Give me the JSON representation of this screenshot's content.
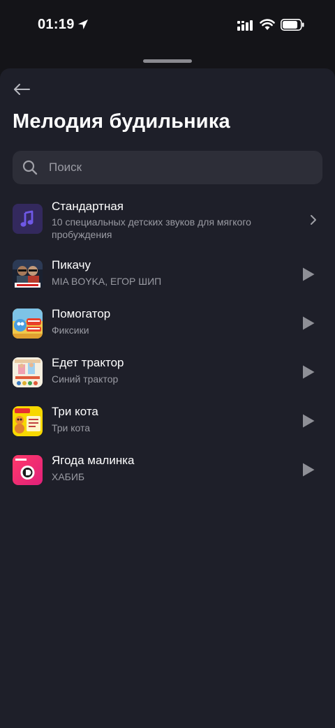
{
  "status_bar": {
    "time": "01:19"
  },
  "header": {
    "title": "Мелодия будильника"
  },
  "search": {
    "placeholder": "Поиск"
  },
  "standard": {
    "title": "Стандартная",
    "subtitle": "10 специальных детских звуков для мягкого пробуждения"
  },
  "tracks": [
    {
      "title": "Пикачу",
      "artist": "MIA BOYKA, ЕГОР ШИП"
    },
    {
      "title": "Помогатор",
      "artist": "Фиксики"
    },
    {
      "title": "Едет трактор",
      "artist": "Синий трактор"
    },
    {
      "title": "Три кота",
      "artist": "Три кота"
    },
    {
      "title": "Ягода малинка",
      "artist": "ХАБИБ"
    }
  ],
  "colors": {
    "background": "#141418",
    "sheet": "#1e1f29",
    "search_field": "#2d2e38",
    "accent_purple": "#6f58e6",
    "secondary_text": "#9a9ba3"
  }
}
